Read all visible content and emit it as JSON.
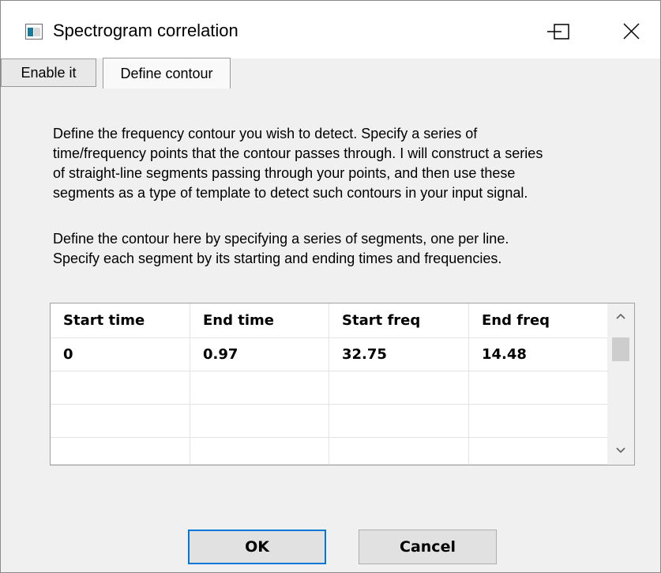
{
  "window": {
    "title": "Spectrogram correlation",
    "controls": {
      "minimize_icon": "minimize-icon",
      "maximize_icon": "maximize-icon",
      "close_icon": "close-icon"
    }
  },
  "tabs": [
    {
      "label": "Enable it",
      "selected": false
    },
    {
      "label": "Define contour",
      "selected": true
    }
  ],
  "description": {
    "paragraph1": [
      "Define the frequency contour you wish to detect. Specify a series of",
      "time/frequency points that the contour passes through. I will construct a series",
      "of straight-line segments passing through your points, and then use these",
      "segments as a type of template to detect such contours in your input signal."
    ],
    "paragraph2": [
      "Define the contour here by specifying a series of segments, one per line.",
      "Specify each segment by its starting and ending times and frequencies."
    ]
  },
  "table": {
    "columns": [
      "Start time",
      "End time",
      "Start freq",
      "End freq"
    ],
    "rows": [
      [
        "0",
        "0.97",
        "32.75",
        "14.48"
      ],
      [
        "",
        "",
        "",
        ""
      ],
      [
        "",
        "",
        "",
        ""
      ],
      [
        "",
        "",
        "",
        ""
      ]
    ],
    "scroll_up_icon": "chevron-up-icon",
    "scroll_down_icon": "chevron-down-icon"
  },
  "buttons": {
    "ok": "OK",
    "cancel": "Cancel"
  },
  "colors": {
    "default_button_border": "#0078d7",
    "app_icon": "#1a7a9a"
  }
}
